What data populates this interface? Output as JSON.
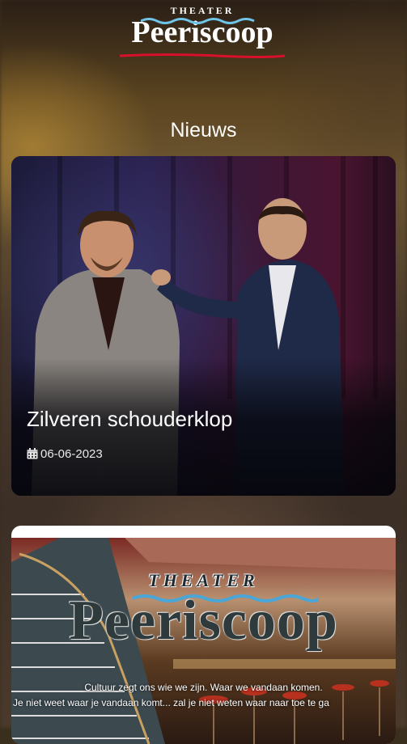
{
  "header": {
    "logo_small": "THEATER",
    "logo_big": "Peeriscoop"
  },
  "section": {
    "title": "Nieuws"
  },
  "news": [
    {
      "title": "Zilveren schouderklop",
      "date": "06-06-2023",
      "date_icon": "calendar-icon"
    },
    {
      "logo_small": "THEATER",
      "logo_big": "Peeriscoop",
      "line1": "Cultuur zegt ons wie we zijn. Waar we vandaan komen.",
      "line2": "Je niet weet waar je vandaan komt... zal je niet weten waar naar toe te ga"
    }
  ],
  "colors": {
    "logo_accent": "#d8102c",
    "card1_bg": "#1a1830"
  }
}
